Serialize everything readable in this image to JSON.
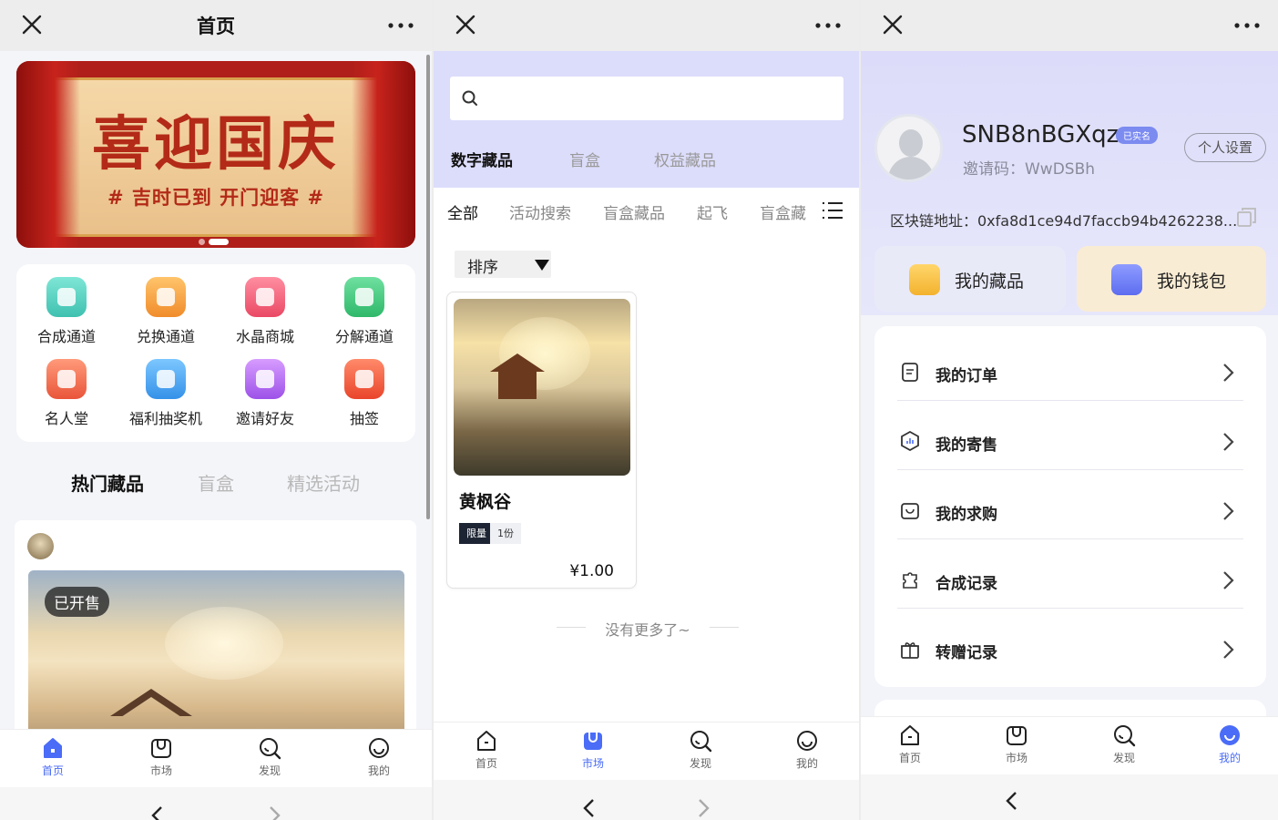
{
  "colors": {
    "accent": "#4a6cf7",
    "lavender": "#dcdcfb",
    "brand_red": "#b32a18"
  },
  "panel1": {
    "title": "首页",
    "banner": {
      "title": "喜迎国庆",
      "subtitle": "# 吉时已到 开门迎客 #"
    },
    "grid": [
      {
        "label": "合成通道",
        "icon": "star-icon",
        "color": "#5fd4c4"
      },
      {
        "label": "兑换通道",
        "icon": "wallet-icon",
        "color": "#f7a23f"
      },
      {
        "label": "水晶商城",
        "icon": "shop-icon",
        "color": "#f2607a"
      },
      {
        "label": "分解通道",
        "icon": "bag-icon",
        "color": "#42c97d"
      },
      {
        "label": "名人堂",
        "icon": "trophy-icon",
        "color": "#f06a4f"
      },
      {
        "label": "福利抽奖机",
        "icon": "gift-icon",
        "color": "#4aa8f2"
      },
      {
        "label": "邀请好友",
        "icon": "invite-icon",
        "color": "#b56df0"
      },
      {
        "label": "抽签",
        "icon": "lottery-icon",
        "color": "#f05a3c"
      }
    ],
    "tabs": [
      "热门藏品",
      "盲盒",
      "精选活动"
    ],
    "feed": {
      "badge": "已开售"
    },
    "nav": [
      "首页",
      "市场",
      "发现",
      "我的"
    ]
  },
  "panel2": {
    "search": {
      "placeholder": ""
    },
    "category_tabs": [
      "数字藏品",
      "盲盒",
      "权益藏品"
    ],
    "sub_tabs": [
      "全部",
      "活动搜索",
      "盲盒藏品",
      "起飞",
      "盲盒藏"
    ],
    "sort_label": "排序",
    "item": {
      "name": "黄枫谷",
      "tag_limit": "限量",
      "tag_count": "1份",
      "price": "¥1.00"
    },
    "no_more": "没有更多了~",
    "nav": [
      "首页",
      "市场",
      "发现",
      "我的"
    ]
  },
  "panel3": {
    "username": "SNB8nBGXqz",
    "verified": "已实名",
    "invite_code": "邀请码：WwDSBh",
    "settings": "个人设置",
    "chain_address": "区块链地址：0xfa8d1ce94d7faccb94b4262238...",
    "assets": [
      {
        "label": "我的藏品",
        "icon": "collection-icon"
      },
      {
        "label": "我的钱包",
        "icon": "wallet-cube-icon"
      }
    ],
    "menu": [
      {
        "label": "我的订单",
        "icon": "order-icon"
      },
      {
        "label": "我的寄售",
        "icon": "consign-icon"
      },
      {
        "label": "我的求购",
        "icon": "purchase-icon"
      },
      {
        "label": "合成记录",
        "icon": "puzzle-icon"
      },
      {
        "label": "转赠记录",
        "icon": "gift-record-icon"
      }
    ],
    "nav": [
      "首页",
      "市场",
      "发现",
      "我的"
    ]
  }
}
